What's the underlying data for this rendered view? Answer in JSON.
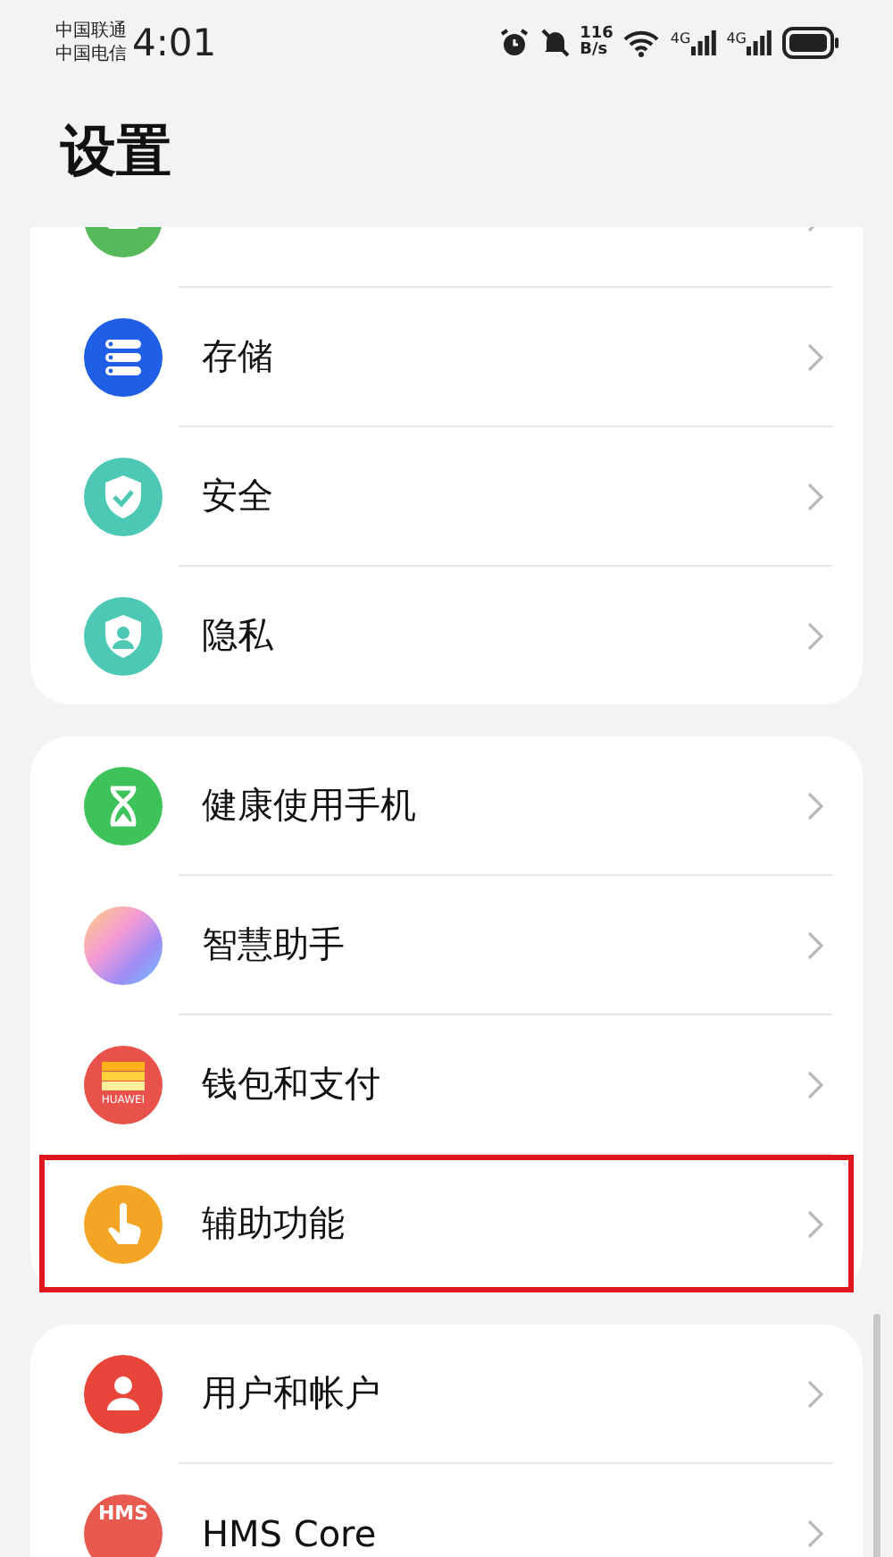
{
  "status_bar": {
    "carriers": [
      "中国联通",
      "中国电信"
    ],
    "time": "4:01",
    "speed": "116",
    "speed_unit": "B/s",
    "signals": [
      "4G",
      "4G"
    ]
  },
  "title": "设置",
  "groups": [
    {
      "items": [
        {
          "highlighted": false
        },
        {
          "label": "存储",
          "highlighted": false
        },
        {
          "label": "安全",
          "highlighted": false
        },
        {
          "label": "隐私",
          "highlighted": false
        }
      ]
    },
    {
      "items": [
        {
          "label": "健康使用手机",
          "highlighted": false
        },
        {
          "label": "智慧助手",
          "highlighted": false
        },
        {
          "label": "钱包和支付",
          "highlighted": false,
          "icon_text": "HUAWEI"
        },
        {
          "label": "辅助功能",
          "highlighted": true
        }
      ]
    },
    {
      "items": [
        {
          "label": "用户和帐户",
          "highlighted": false
        },
        {
          "label": "HMS Core",
          "highlighted": false,
          "icon_text": "HMS"
        }
      ]
    }
  ]
}
